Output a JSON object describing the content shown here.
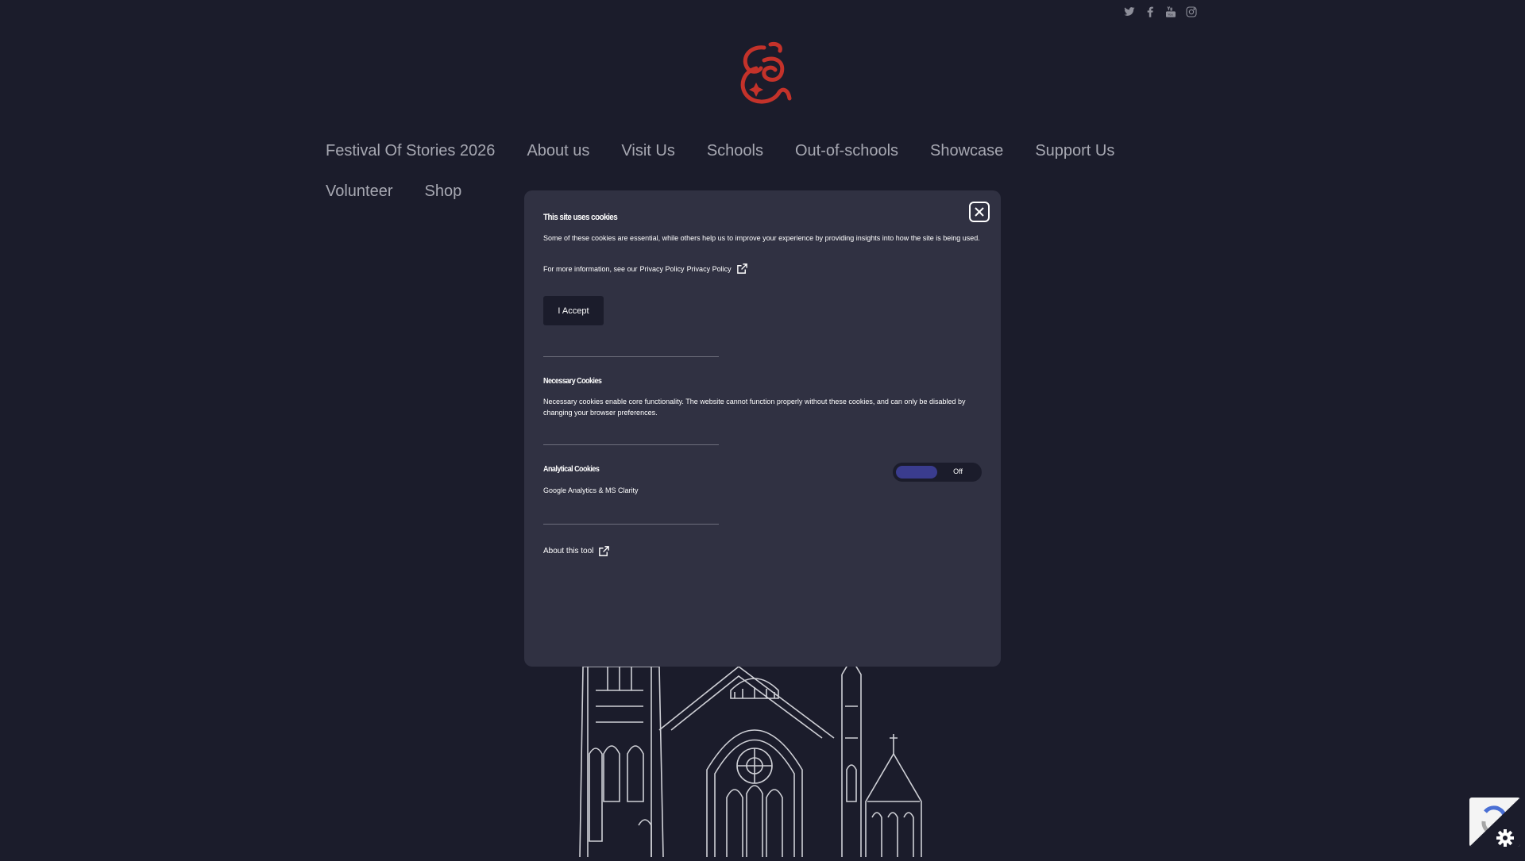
{
  "social": {
    "icons": [
      "twitter-icon",
      "facebook-icon",
      "youtube-icon",
      "instagram-icon"
    ]
  },
  "nav": {
    "row1": [
      "Festival Of Stories 2026",
      "About us",
      "Visit Us",
      "Schools",
      "Out-of-schools",
      "Showcase",
      "Support Us"
    ],
    "row2": [
      "Volunteer",
      "Shop"
    ]
  },
  "cookie_modal": {
    "title": "This site uses cookies",
    "intro": "Some of these cookies are essential, while others help us to improve your experience by providing insights into how the site is being used.",
    "info_prefix": "For more information, see our",
    "privacy_link_1": "Privacy Policy",
    "privacy_link_2": "Privacy Policy",
    "accept_label": "I Accept",
    "necessary_title": "Necessary Cookies",
    "necessary_text": "Necessary cookies enable core functionality. The website cannot function properly without these cookies, and can only be disabled by changing your browser preferences.",
    "analytical_title": "Analytical Cookies",
    "analytical_text": "Google Analytics & MS Clarity",
    "toggle_state": "Off",
    "about_tool": "About this tool"
  },
  "colors": {
    "background": "#1b1c2b",
    "modal": "#303142",
    "logo": "#c4322a",
    "toggle_knob": "#3a3c8e"
  }
}
